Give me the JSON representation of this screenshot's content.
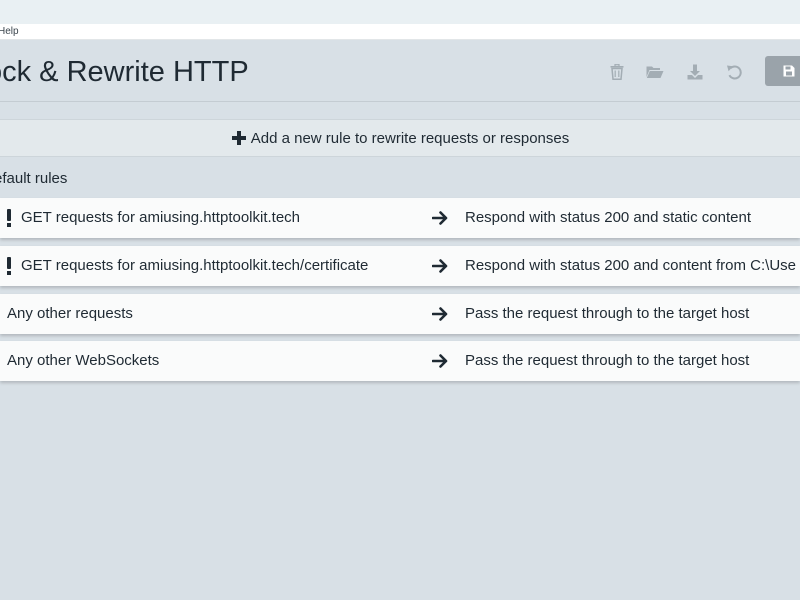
{
  "menu": {
    "help_label": "Help"
  },
  "header": {
    "title": "ock & Rewrite HTTP",
    "icons": [
      "trash-icon",
      "folder-open-icon",
      "download-icon",
      "undo-icon",
      "save-icon"
    ]
  },
  "add_rule": {
    "label": "Add a new rule to rewrite requests or responses"
  },
  "groups": [
    {
      "title": "efault rules",
      "rules": [
        {
          "warning": true,
          "matcher": "GET requests for amiusing.httptoolkit.tech",
          "handler": "Respond with status 200 and static content"
        },
        {
          "warning": true,
          "matcher": "GET requests for amiusing.httptoolkit.tech/certificate",
          "handler": "Respond with status 200 and content from C:\\Use"
        },
        {
          "warning": false,
          "matcher": "Any other requests",
          "handler": "Pass the request through to the target host"
        },
        {
          "warning": false,
          "matcher": "Any other WebSockets",
          "handler": "Pass the request through to the target host"
        }
      ]
    }
  ],
  "colors": {
    "background": "#d8e0e6",
    "row_background": "#fafbfb",
    "text": "#1f2a33",
    "icon_muted": "#a3adb4",
    "save_button": "#9aa3aa"
  }
}
